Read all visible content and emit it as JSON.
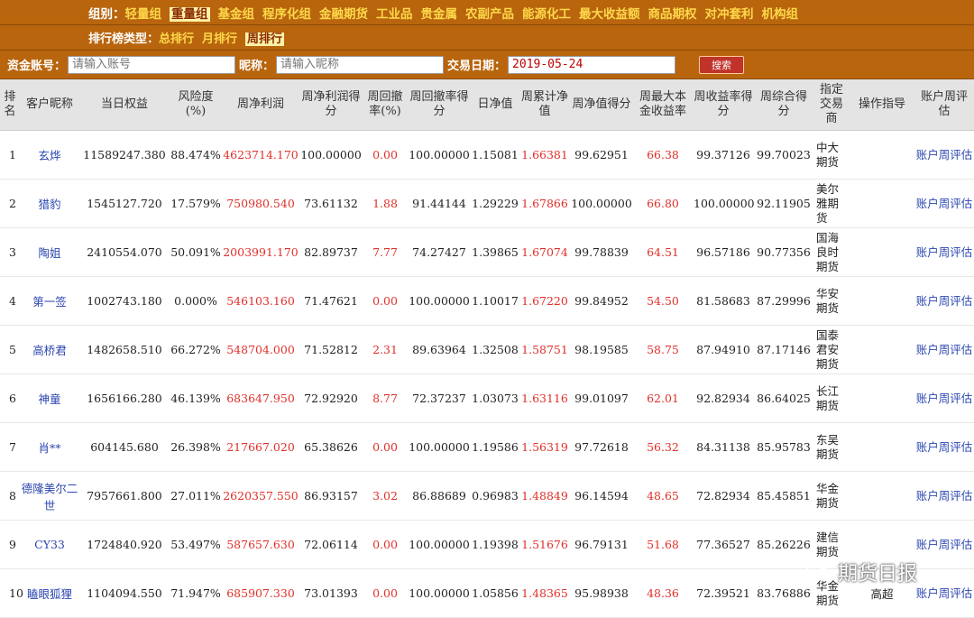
{
  "groups": {
    "label": "组别：",
    "items": [
      "轻量组",
      "重量组",
      "基金组",
      "程序化组",
      "金融期货",
      "工业品",
      "贵金属",
      "农副产品",
      "能源化工",
      "最大收益额",
      "商品期权",
      "对冲套利",
      "机构组"
    ],
    "selected": 1
  },
  "rank_type": {
    "label": "排行榜类型：",
    "items": [
      "总排行",
      "月排行",
      "周排行"
    ],
    "selected": 2
  },
  "search": {
    "account_label": "资金账号：",
    "account_placeholder": "请输入账号",
    "nick_label": "昵称：",
    "nick_placeholder": "请输入昵称",
    "date_label": "交易日期：",
    "date_value": "2019-05-24",
    "button": "搜索"
  },
  "table": {
    "headers": [
      "排名",
      "客户昵称",
      "当日权益",
      "风险度(%)",
      "周净利润",
      "周净利润得分",
      "周回撤率(%)",
      "周回撤率得分",
      "日净值",
      "周累计净值",
      "周净值得分",
      "周最大本金收益率",
      "周收益率得分",
      "周综合得分",
      "指定交易商",
      "操作指导",
      "账户周评估"
    ],
    "rows": [
      {
        "rank": "1",
        "name": "玄烨",
        "equity": "11589247.380",
        "risk": "88.474%",
        "profit": "4623714.170",
        "profit_score": "100.00000",
        "drawdown": "0.00",
        "dd_score": "100.00000",
        "nav": "1.15081",
        "cum_nav": "1.66381",
        "nav_score": "99.62951",
        "max_ret": "66.38",
        "ret_score": "99.37126",
        "total": "99.70023",
        "broker": "中大期货",
        "guide": "",
        "eval": "账户周评估"
      },
      {
        "rank": "2",
        "name": "猎豹",
        "equity": "1545127.720",
        "risk": "17.579%",
        "profit": "750980.540",
        "profit_score": "73.61132",
        "drawdown": "1.88",
        "dd_score": "91.44144",
        "nav": "1.29229",
        "cum_nav": "1.67866",
        "nav_score": "100.00000",
        "max_ret": "66.80",
        "ret_score": "100.00000",
        "total": "92.11905",
        "broker": "美尔雅期货",
        "guide": "",
        "eval": "账户周评估"
      },
      {
        "rank": "3",
        "name": "陶姐",
        "equity": "2410554.070",
        "risk": "50.091%",
        "profit": "2003991.170",
        "profit_score": "82.89737",
        "drawdown": "7.77",
        "dd_score": "74.27427",
        "nav": "1.39865",
        "cum_nav": "1.67074",
        "nav_score": "99.78839",
        "max_ret": "64.51",
        "ret_score": "96.57186",
        "total": "90.77356",
        "broker": "国海良时期货",
        "guide": "",
        "eval": "账户周评估"
      },
      {
        "rank": "4",
        "name": "第一签",
        "equity": "1002743.180",
        "risk": "0.000%",
        "profit": "546103.160",
        "profit_score": "71.47621",
        "drawdown": "0.00",
        "dd_score": "100.00000",
        "nav": "1.10017",
        "cum_nav": "1.67220",
        "nav_score": "99.84952",
        "max_ret": "54.50",
        "ret_score": "81.58683",
        "total": "87.29996",
        "broker": "华安期货",
        "guide": "",
        "eval": "账户周评估"
      },
      {
        "rank": "5",
        "name": "高桥君",
        "equity": "1482658.510",
        "risk": "66.272%",
        "profit": "548704.000",
        "profit_score": "71.52812",
        "drawdown": "2.31",
        "dd_score": "89.63964",
        "nav": "1.32508",
        "cum_nav": "1.58751",
        "nav_score": "98.19585",
        "max_ret": "58.75",
        "ret_score": "87.94910",
        "total": "87.17146",
        "broker": "国泰君安期货",
        "guide": "",
        "eval": "账户周评估"
      },
      {
        "rank": "6",
        "name": "神童",
        "equity": "1656166.280",
        "risk": "46.139%",
        "profit": "683647.950",
        "profit_score": "72.92920",
        "drawdown": "8.77",
        "dd_score": "72.37237",
        "nav": "1.03073",
        "cum_nav": "1.63116",
        "nav_score": "99.01097",
        "max_ret": "62.01",
        "ret_score": "92.82934",
        "total": "86.64025",
        "broker": "长江期货",
        "guide": "",
        "eval": "账户周评估"
      },
      {
        "rank": "7",
        "name": "肖**",
        "equity": "604145.680",
        "risk": "26.398%",
        "profit": "217667.020",
        "profit_score": "65.38626",
        "drawdown": "0.00",
        "dd_score": "100.00000",
        "nav": "1.19586",
        "cum_nav": "1.56319",
        "nav_score": "97.72618",
        "max_ret": "56.32",
        "ret_score": "84.31138",
        "total": "85.95783",
        "broker": "东吴期货",
        "guide": "",
        "eval": "账户周评估"
      },
      {
        "rank": "8",
        "name": "德隆美尔二世",
        "equity": "7957661.800",
        "risk": "27.011%",
        "profit": "2620357.550",
        "profit_score": "86.93157",
        "drawdown": "3.02",
        "dd_score": "86.88689",
        "nav": "0.96983",
        "cum_nav": "1.48849",
        "nav_score": "96.14594",
        "max_ret": "48.65",
        "ret_score": "72.82934",
        "total": "85.45851",
        "broker": "华金期货",
        "guide": "",
        "eval": "账户周评估"
      },
      {
        "rank": "9",
        "name": "CY33",
        "equity": "1724840.920",
        "risk": "53.497%",
        "profit": "587657.630",
        "profit_score": "72.06114",
        "drawdown": "0.00",
        "dd_score": "100.00000",
        "nav": "1.19398",
        "cum_nav": "1.51676",
        "nav_score": "96.79131",
        "max_ret": "51.68",
        "ret_score": "77.36527",
        "total": "85.26226",
        "broker": "建信期货",
        "guide": "",
        "eval": "账户周评估"
      },
      {
        "rank": "10",
        "name": "瞌眼狐狸",
        "equity": "1104094.550",
        "risk": "71.947%",
        "profit": "685907.330",
        "profit_score": "73.01393",
        "drawdown": "0.00",
        "dd_score": "100.00000",
        "nav": "1.05856",
        "cum_nav": "1.48365",
        "nav_score": "95.98938",
        "max_ret": "48.36",
        "ret_score": "72.39521",
        "total": "83.76886",
        "broker": "华金期货",
        "guide": "高超",
        "eval": "账户周评估"
      }
    ]
  },
  "watermark": "期货日报"
}
